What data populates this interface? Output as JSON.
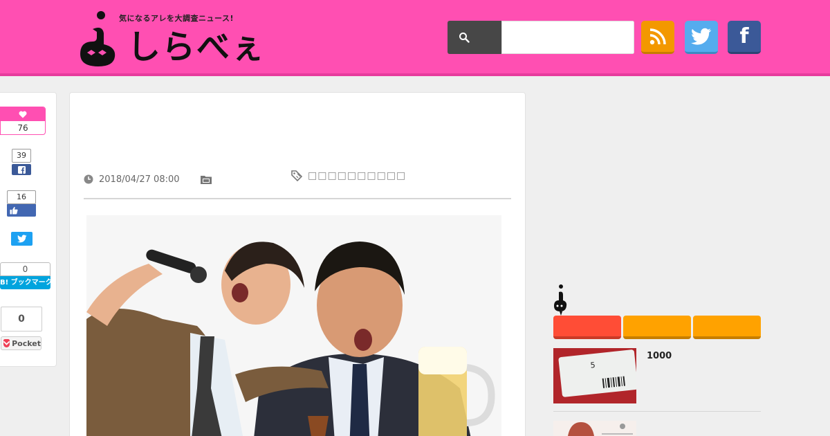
{
  "site": {
    "tagline": "気になるアレを大調査ニュース!",
    "logo_text": "しらべぇ"
  },
  "search": {
    "placeholder": "",
    "button_icon": "search-icon"
  },
  "social": {
    "rss_icon": "rss-icon",
    "twitter_icon": "twitter-bird-icon",
    "facebook_letter": "f"
  },
  "share": {
    "like_count": "76",
    "facebook_share_count": "39",
    "facebook_like_count": "16",
    "hatena_count": "0",
    "hatena_label": "B! ブックマーク",
    "pocket_count": "0",
    "pocket_label": "Pocket"
  },
  "article": {
    "date": "2018/04/27 08:00",
    "tags_text": "□□□□□□□□□□",
    "image_subject": "two-salarymen-karaoke-beer"
  },
  "sidebar": {
    "ranking_items": [
      {
        "title": "1000"
      },
      {
        "title": ""
      }
    ]
  },
  "colors": {
    "header_pink": "#ff4fb2",
    "rss_orange": "#f39800",
    "twitter_blue": "#55acee",
    "facebook_blue": "#3b5998",
    "tab_red": "#ff4d36",
    "tab_orange": "#ffa200"
  }
}
